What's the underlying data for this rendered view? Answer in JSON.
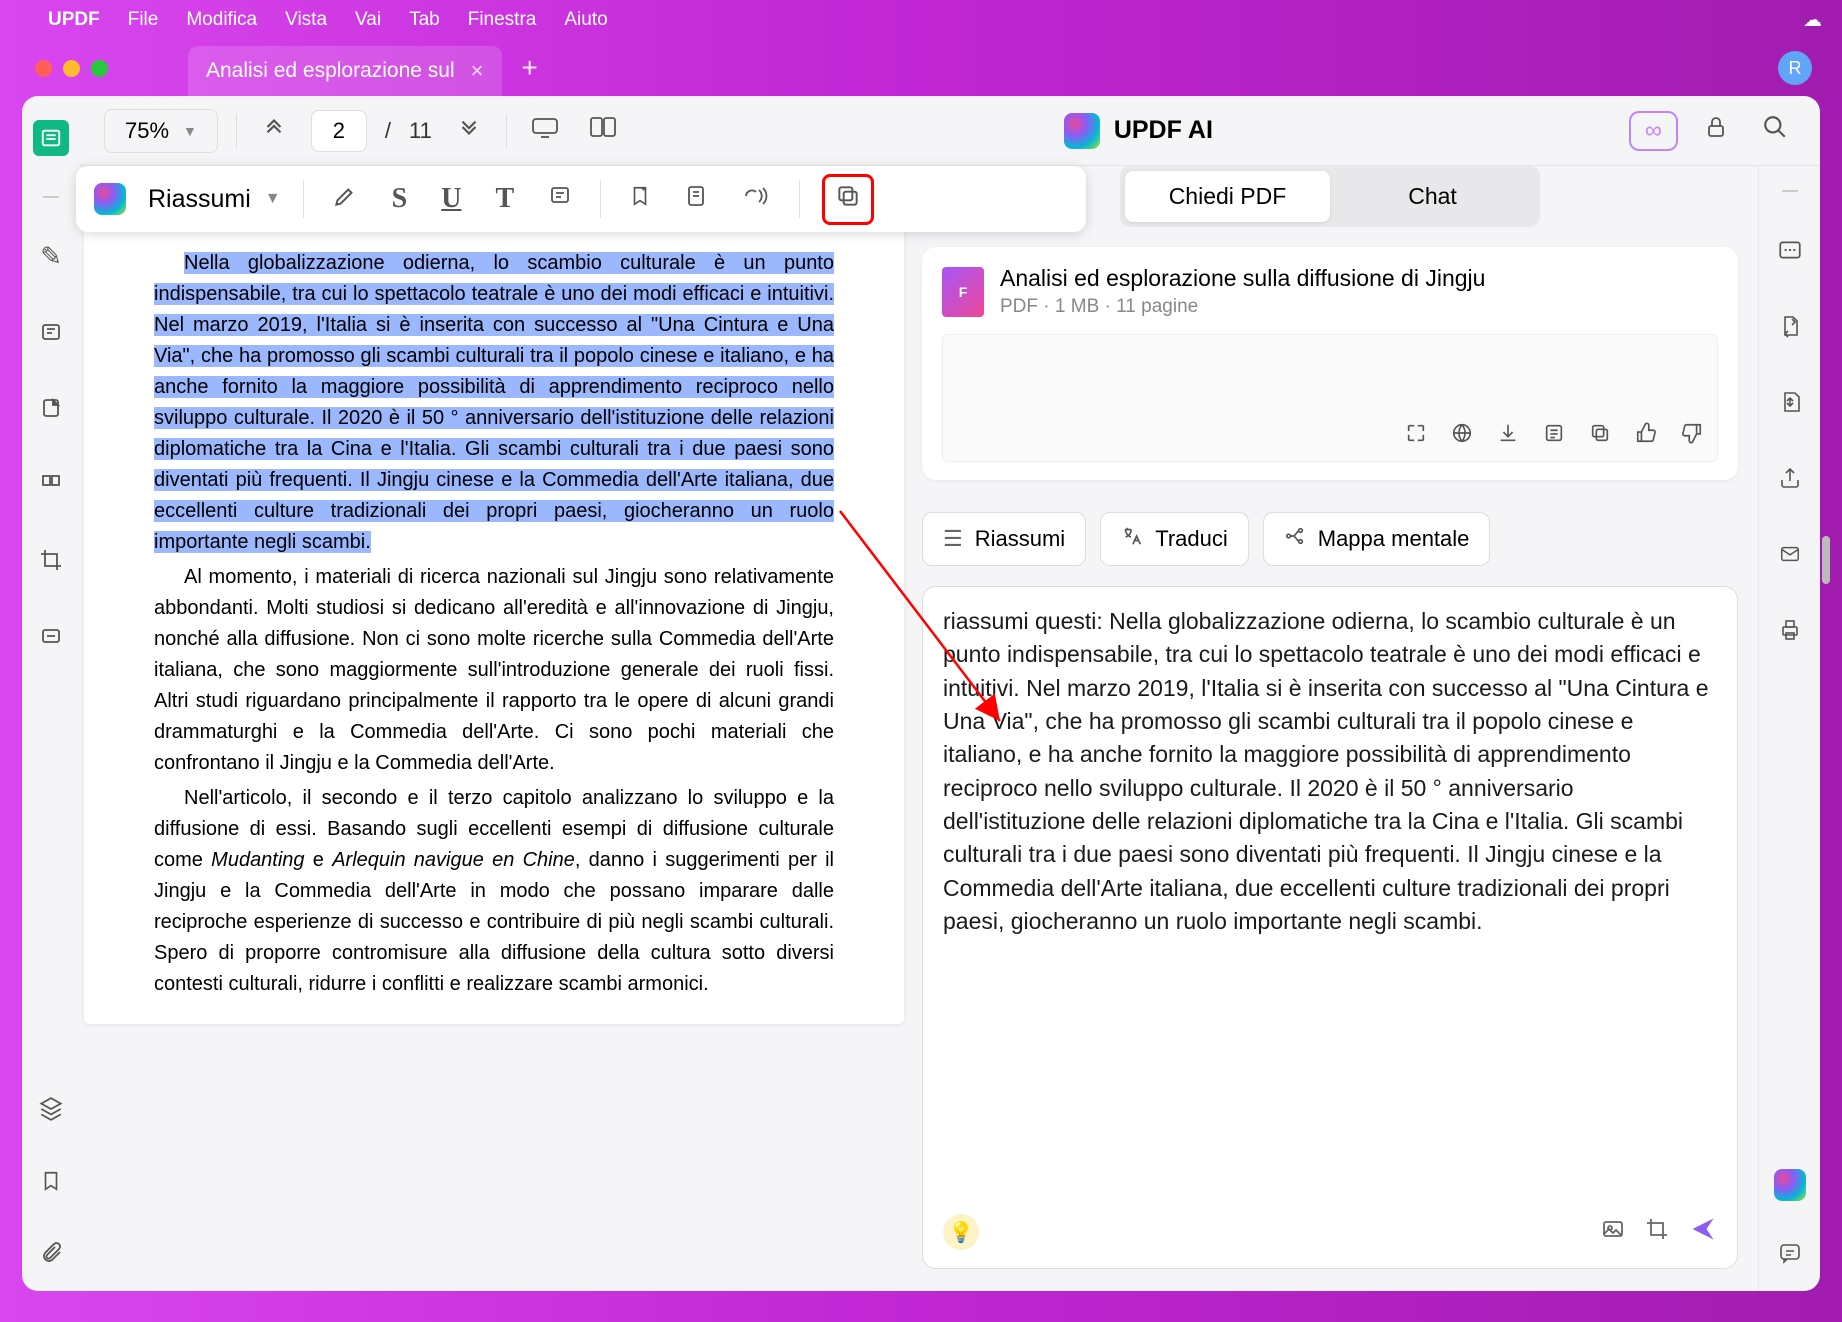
{
  "menubar": {
    "app": "UPDF",
    "items": [
      "File",
      "Modifica",
      "Vista",
      "Vai",
      "Tab",
      "Finestra",
      "Aiuto"
    ]
  },
  "tab": {
    "title": "Analisi ed esplorazione sul"
  },
  "user_initial": "R",
  "toolbar": {
    "zoom": "75%",
    "page_current": "2",
    "page_total": "11"
  },
  "context_toolbar": {
    "action": "Riassumi"
  },
  "doc": {
    "highlighted": "Nella globalizzazione odierna, lo scambio culturale è un punto indispensabile, tra cui lo spettacolo teatrale è uno dei modi efficaci e intuitivi. Nel marzo 2019, l'Italia si è inserita con successo al \"Una Cintura e Una Via\", che ha promosso gli scambi culturali tra il popolo cinese e italiano, e ha anche fornito la maggiore possibilità di apprendimento reciproco nello sviluppo culturale. Il 2020 è il 50 ° anniversario dell'istituzione delle relazioni diplomatiche tra la Cina e l'Italia. Gli scambi culturali tra i due paesi sono diventati più frequenti. Il Jingju cinese e la Commedia dell'Arte italiana, due eccellenti culture tradizionali dei propri paesi, giocheranno un ruolo importante negli scambi.",
    "p2a": "Al momento, i materiali di ricerca nazionali sul Jingju sono relativamente abbondanti. Molti studiosi si dedicano all'eredità e all'innovazione di Jingju, nonché alla diffusione. Non ci sono molte ricerche sulla Commedia dell'Arte italiana, che sono maggiormente sull'introduzione generale dei ruoli fissi. Altri studi riguardano principalmente il rapporto tra le opere di alcuni grandi drammaturghi e la Commedia dell'Arte. Ci sono pochi materiali che confrontano il Jingju e la Commedia dell'Arte.",
    "p3a": "Nell'articolo, il secondo e il terzo capitolo analizzano lo sviluppo e la diffusione di essi. Basando sugli eccellenti esempi di diffusione culturale come ",
    "p3_it1": "Mudanting",
    "p3b": " e ",
    "p3_it2": "Arlequin navigue en Chine",
    "p3c": ", danno i suggerimenti per il Jingju e la Commedia dell'Arte in modo che possano imparare dalle reciproche esperienze di successo e contribuire di più negli scambi culturali. Spero di proporre contromisure alla diffusione della cultura sotto diversi contesti culturali, ridurre i conflitti e realizzare scambi armonici."
  },
  "ai": {
    "title": "UPDF AI",
    "tab_ask": "Chiedi PDF",
    "tab_chat": "Chat",
    "doc_title": "Analisi ed esplorazione sulla diffusione di Jingju",
    "doc_meta_type": "PDF",
    "doc_meta_size": "1 MB",
    "doc_meta_pages": "11 pagine",
    "pills": {
      "summarize": "Riassumi",
      "translate": "Traduci",
      "mindmap": "Mappa mentale"
    },
    "input_text": "riassumi questi: Nella globalizzazione odierna, lo scambio culturale è un punto indispensabile, tra cui lo spettacolo teatrale è uno dei modi efficaci e intuitivi. Nel marzo 2019, l'Italia si è inserita con successo al \"Una Cintura e Una Via\", che ha promosso gli scambi culturali tra il popolo cinese e italiano, e ha anche fornito la maggiore possibilità di apprendimento reciproco nello sviluppo culturale. Il 2020 è il 50 ° anniversario dell'istituzione delle relazioni diplomatiche tra la Cina e l'Italia. Gli scambi culturali tra i due paesi sono diventati più frequenti. Il Jingju cinese e la Commedia dell'Arte italiana, due eccellenti culture tradizionali dei propri paesi, giocheranno un ruolo importante negli scambi."
  }
}
